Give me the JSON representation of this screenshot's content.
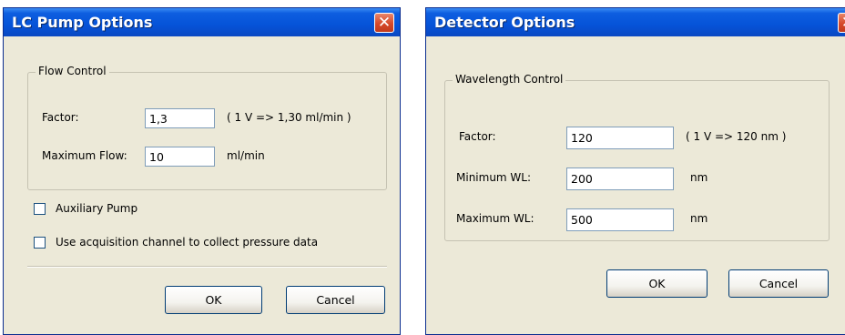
{
  "lc_pump": {
    "title": "LC Pump Options",
    "close_label": "✕",
    "group_label": "Flow Control",
    "factor_label": "Factor:",
    "factor_value": "1,3",
    "factor_hint": "( 1 V => 1,30 ml/min )",
    "max_flow_label": "Maximum Flow:",
    "max_flow_value": "10",
    "max_flow_unit": "ml/min",
    "auxiliary_label": "Auxiliary Pump",
    "acquisition_label": "Use acquisition channel to collect pressure data",
    "ok_label": "OK",
    "cancel_label": "Cancel"
  },
  "detector": {
    "title": "Detector Options",
    "close_label": "✕",
    "group_label": "Wavelength Control",
    "factor_label": "Factor:",
    "factor_value": "120",
    "factor_hint": "( 1 V => 120 nm )",
    "min_wl_label": "Minimum WL:",
    "min_wl_value": "200",
    "min_wl_unit": "nm",
    "max_wl_label": "Maximum WL:",
    "max_wl_value": "500",
    "max_wl_unit": "nm",
    "ok_label": "OK",
    "cancel_label": "Cancel"
  }
}
